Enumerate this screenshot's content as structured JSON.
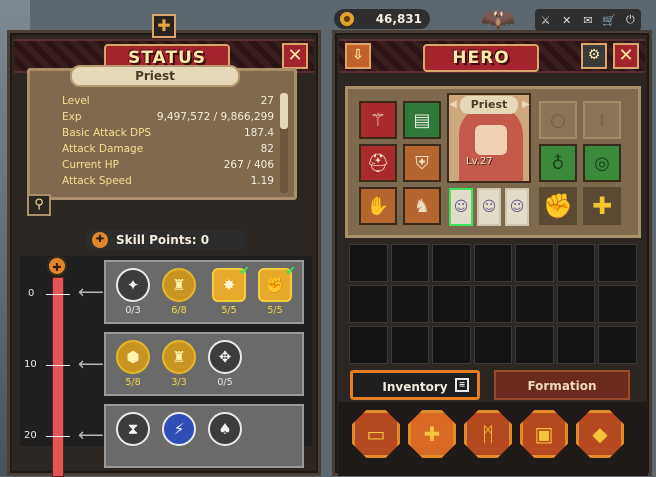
{
  "status": {
    "title": "STATUS",
    "close": "✕",
    "class_name": "Priest",
    "stats": [
      {
        "label": "Level",
        "value": "27"
      },
      {
        "label": "Exp",
        "value": "9,497,572 / 9,866,299"
      },
      {
        "label": "Basic Attack DPS",
        "value": "187.4"
      },
      {
        "label": "Attack Damage",
        "value": "82"
      },
      {
        "label": "Current HP",
        "value": "267 / 406"
      },
      {
        "label": "Attack Speed",
        "value": "1.19"
      }
    ],
    "skill_points_label": "Skill Points: 0",
    "levels": [
      "0",
      "10",
      "20"
    ],
    "skill_rows": [
      [
        {
          "icon": "✦",
          "count": "0/3",
          "style": "plain"
        },
        {
          "icon": "♜",
          "count": "6/8",
          "style": "gold"
        },
        {
          "icon": "✸",
          "count": "5/5",
          "style": "gold-full"
        },
        {
          "icon": "✊",
          "count": "5/5",
          "style": "gold-full"
        }
      ],
      [
        {
          "icon": "⬢",
          "count": "5/8",
          "style": "gold"
        },
        {
          "icon": "♜",
          "count": "3/3",
          "style": "gold"
        },
        {
          "icon": "✥",
          "count": "0/5",
          "style": "plain"
        }
      ],
      [
        {
          "icon": "⧗",
          "count": "",
          "style": "plain"
        },
        {
          "icon": "⚡",
          "count": "",
          "style": "blue"
        },
        {
          "icon": "♠",
          "count": "",
          "style": "plain"
        }
      ]
    ]
  },
  "hero": {
    "title": "HERO",
    "close": "✕",
    "gold": "46,831",
    "name": "Priest",
    "level": "Lv.27",
    "tabs": {
      "inventory": "Inventory",
      "formation": "Formation"
    },
    "colors": {
      "accent": "#e67d22",
      "title_red": "#a3242c",
      "frame": "#d8a56a"
    }
  }
}
